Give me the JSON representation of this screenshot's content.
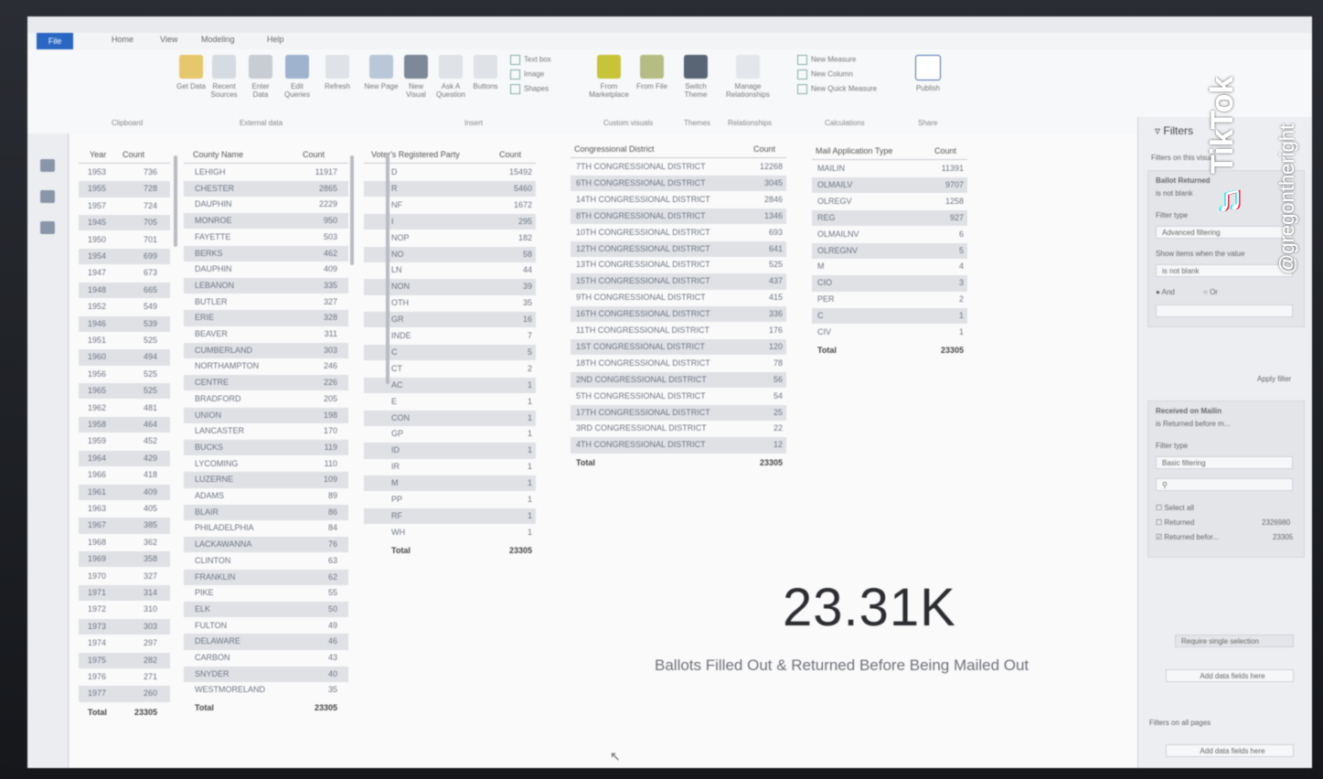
{
  "ribbon": {
    "tabs": [
      "File",
      "Home",
      "View",
      "Modeling",
      "Help"
    ],
    "buttons": [
      "Get Data",
      "Recent Sources",
      "Enter Data",
      "Edit Queries",
      "Refresh",
      "New Page",
      "New Visual",
      "Ask A Question",
      "Buttons",
      "Text box",
      "Image",
      "Shapes",
      "From Marketplace",
      "From File",
      "Switch Theme",
      "Manage Relationships",
      "Publish"
    ],
    "calc_items": [
      "New Measure",
      "New Column",
      "New Quick Measure"
    ],
    "groups": [
      "Clipboard",
      "External data",
      "Insert",
      "Custom visuals",
      "Themes",
      "Relationships",
      "Calculations",
      "Share"
    ]
  },
  "table_year": {
    "headers": [
      "Year",
      "Count"
    ],
    "rows": [
      [
        "1953",
        "736"
      ],
      [
        "1955",
        "728"
      ],
      [
        "1957",
        "724"
      ],
      [
        "1945",
        "705"
      ],
      [
        "1950",
        "701"
      ],
      [
        "1954",
        "699"
      ],
      [
        "1947",
        "673"
      ],
      [
        "1948",
        "665"
      ],
      [
        "1952",
        "549"
      ],
      [
        "1946",
        "539"
      ],
      [
        "1951",
        "525"
      ],
      [
        "1960",
        "494"
      ],
      [
        "1956",
        "525"
      ],
      [
        "1965",
        "525"
      ],
      [
        "1962",
        "481"
      ],
      [
        "1958",
        "464"
      ],
      [
        "1959",
        "452"
      ],
      [
        "1964",
        "429"
      ],
      [
        "1966",
        "418"
      ],
      [
        "1961",
        "409"
      ],
      [
        "1963",
        "405"
      ],
      [
        "1967",
        "385"
      ],
      [
        "1968",
        "362"
      ],
      [
        "1969",
        "358"
      ],
      [
        "1970",
        "327"
      ],
      [
        "1971",
        "314"
      ],
      [
        "1972",
        "310"
      ],
      [
        "1973",
        "303"
      ],
      [
        "1974",
        "297"
      ],
      [
        "1975",
        "282"
      ],
      [
        "1976",
        "271"
      ],
      [
        "1977",
        "260"
      ]
    ],
    "total_label": "Total",
    "total_value": "23305"
  },
  "table_county": {
    "headers": [
      "County Name",
      "Count"
    ],
    "rows": [
      [
        "LEHIGH",
        "11917"
      ],
      [
        "CHESTER",
        "2865"
      ],
      [
        "DAUPHIN",
        "2229"
      ],
      [
        "MONROE",
        "950"
      ],
      [
        "FAYETTE",
        "503"
      ],
      [
        "BERKS",
        "462"
      ],
      [
        "DAUPHIN",
        "409"
      ],
      [
        "LEBANON",
        "335"
      ],
      [
        "BUTLER",
        "327"
      ],
      [
        "ERIE",
        "328"
      ],
      [
        "BEAVER",
        "311"
      ],
      [
        "CUMBERLAND",
        "303"
      ],
      [
        "NORTHAMPTON",
        "246"
      ],
      [
        "CENTRE",
        "226"
      ],
      [
        "BRADFORD",
        "205"
      ],
      [
        "UNION",
        "198"
      ],
      [
        "LANCASTER",
        "170"
      ],
      [
        "BUCKS",
        "119"
      ],
      [
        "LYCOMING",
        "110"
      ],
      [
        "LUZERNE",
        "109"
      ],
      [
        "ADAMS",
        "89"
      ],
      [
        "BLAIR",
        "86"
      ],
      [
        "PHILADELPHIA",
        "84"
      ],
      [
        "LACKAWANNA",
        "76"
      ],
      [
        "CLINTON",
        "63"
      ],
      [
        "FRANKLIN",
        "62"
      ],
      [
        "PIKE",
        "55"
      ],
      [
        "ELK",
        "50"
      ],
      [
        "FULTON",
        "49"
      ],
      [
        "DELAWARE",
        "46"
      ],
      [
        "CARBON",
        "43"
      ],
      [
        "SNYDER",
        "40"
      ],
      [
        "WESTMORELAND",
        "35"
      ]
    ],
    "total_label": "Total",
    "total_value": "23305"
  },
  "table_party": {
    "headers": [
      "Voter's Registered Party",
      "Count"
    ],
    "rows": [
      [
        "D",
        "15492"
      ],
      [
        "R",
        "5460"
      ],
      [
        "NF",
        "1672"
      ],
      [
        "I",
        "295"
      ],
      [
        "NOP",
        "182"
      ],
      [
        "NO",
        "58"
      ],
      [
        "LN",
        "44"
      ],
      [
        "NON",
        "39"
      ],
      [
        "OTH",
        "35"
      ],
      [
        "GR",
        "16"
      ],
      [
        "INDE",
        "7"
      ],
      [
        "C",
        "5"
      ],
      [
        "CT",
        "2"
      ],
      [
        "AC",
        "1"
      ],
      [
        "E",
        "1"
      ],
      [
        "CON",
        "1"
      ],
      [
        "GP",
        "1"
      ],
      [
        "ID",
        "1"
      ],
      [
        "IR",
        "1"
      ],
      [
        "M",
        "1"
      ],
      [
        "PP",
        "1"
      ],
      [
        "RF",
        "1"
      ],
      [
        "WH",
        "1"
      ]
    ],
    "total_label": "Total",
    "total_value": "23305"
  },
  "table_district": {
    "headers": [
      "Congressional District",
      "Count"
    ],
    "rows": [
      [
        "7TH CONGRESSIONAL DISTRICT",
        "12268"
      ],
      [
        "6TH CONGRESSIONAL DISTRICT",
        "3045"
      ],
      [
        "14TH CONGRESSIONAL DISTRICT",
        "2846"
      ],
      [
        "8TH CONGRESSIONAL DISTRICT",
        "1346"
      ],
      [
        "10TH CONGRESSIONAL DISTRICT",
        "693"
      ],
      [
        "12TH CONGRESSIONAL DISTRICT",
        "641"
      ],
      [
        "13TH CONGRESSIONAL DISTRICT",
        "525"
      ],
      [
        "15TH CONGRESSIONAL DISTRICT",
        "437"
      ],
      [
        "9TH CONGRESSIONAL DISTRICT",
        "415"
      ],
      [
        "16TH CONGRESSIONAL DISTRICT",
        "336"
      ],
      [
        "11TH CONGRESSIONAL DISTRICT",
        "176"
      ],
      [
        "1ST CONGRESSIONAL DISTRICT",
        "120"
      ],
      [
        "18TH CONGRESSIONAL DISTRICT",
        "78"
      ],
      [
        "2ND CONGRESSIONAL DISTRICT",
        "56"
      ],
      [
        "5TH CONGRESSIONAL DISTRICT",
        "54"
      ],
      [
        "17TH CONGRESSIONAL DISTRICT",
        "25"
      ],
      [
        "3RD CONGRESSIONAL DISTRICT",
        "22"
      ],
      [
        "4TH CONGRESSIONAL DISTRICT",
        "12"
      ]
    ],
    "total_label": "Total",
    "total_value": "23305"
  },
  "table_mail": {
    "headers": [
      "Mail Application Type",
      "Count"
    ],
    "rows": [
      [
        "MAILIN",
        "11391"
      ],
      [
        "OLMAILV",
        "9707"
      ],
      [
        "OLREGV",
        "1258"
      ],
      [
        "REG",
        "927"
      ],
      [
        "OLMAILNV",
        "6"
      ],
      [
        "OLREGNV",
        "5"
      ],
      [
        "M",
        "4"
      ],
      [
        "CIO",
        "3"
      ],
      [
        "PER",
        "2"
      ],
      [
        "C",
        "1"
      ],
      [
        "CIV",
        "1"
      ]
    ],
    "total_label": "Total",
    "total_value": "23305"
  },
  "kpi": {
    "value": "23.31K",
    "label": "Ballots Filled Out & Returned Before Being Mailed Out"
  },
  "filters": {
    "title": "Filters",
    "on_this_visual": "Filters on this visual",
    "card1_title": "Ballot Returned",
    "card1_sub": "is not blank",
    "filter_type_label": "Filter type",
    "filter_type_value": "Advanced filtering",
    "show_items_label": "Show items when the value",
    "condition_value": "is not blank",
    "radio_and": "And",
    "radio_or": "Or",
    "apply_filter": "Apply filter",
    "card2_title": "Received on Mailin",
    "card2_sub": "is Returned before m...",
    "filter_type2_value": "Basic filtering",
    "select_all": "Select all",
    "option1": "Returned",
    "option1_count": "2326980",
    "option2": "Returned befor...",
    "option2_count": "23305",
    "require_single": "Require single selection",
    "add_data_fields": "Add data fields here",
    "filters_all_pages": "Filters on all pages",
    "add_data_fields2": "Add data fields here"
  },
  "overlay": {
    "brand": "TikTok",
    "handle": "@gregontheright"
  }
}
